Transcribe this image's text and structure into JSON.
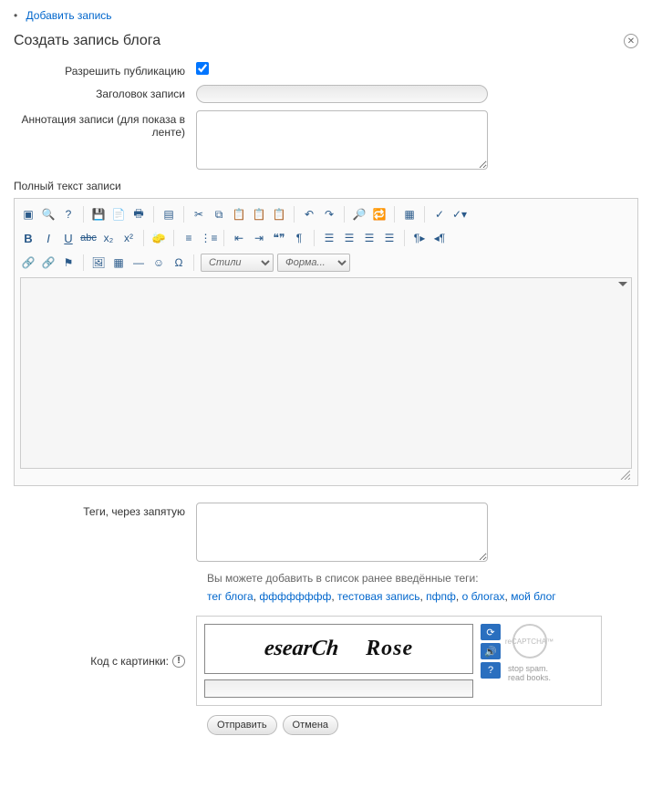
{
  "nav": {
    "add_link": "Добавить запись"
  },
  "title": "Создать запись блога",
  "labels": {
    "publish": "Разрешить публикацию",
    "entry_title": "Заголовок записи",
    "annotation": "Аннотация записи (для показа в ленте)",
    "full_text": "Полный текст записи",
    "tags": "Теги, через запятую",
    "captcha": "Код с картинки:"
  },
  "editor": {
    "styles_placeholder": "Стили",
    "format_placeholder": "Форма..."
  },
  "tags_help": "Вы можете добавить в список ранее введённые теги:",
  "tag_links": [
    "тег блога",
    "фффффффф",
    "тестовая запись",
    "пфпф",
    "о блогах",
    "мой блог"
  ],
  "captcha": {
    "word1": "esearCh",
    "word2": "Rose",
    "brand": "reCAPTCHA™",
    "tag1": "stop spam.",
    "tag2": "read books."
  },
  "buttons": {
    "submit": "Отправить",
    "cancel": "Отмена"
  }
}
